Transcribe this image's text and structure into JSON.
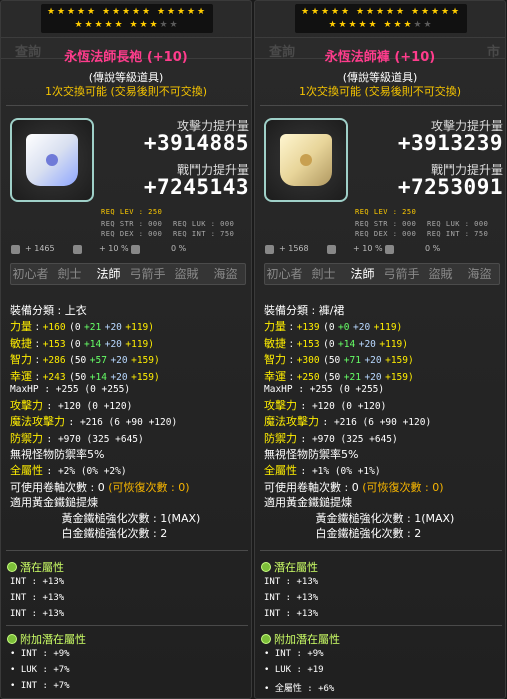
{
  "left": {
    "stars_row1": [
      1,
      1,
      1,
      1,
      1,
      1,
      1,
      1,
      1,
      1,
      1,
      1,
      1,
      1,
      1
    ],
    "stars_row2": [
      1,
      1,
      1,
      1,
      1,
      1,
      1,
      1,
      0,
      0
    ],
    "title": "永恆法師長袍 (+10)",
    "grade": "(傳說等級道具)",
    "trade": "1次交換可能 (交易後則不可交換)",
    "atk_label": "攻擊力提升量",
    "atk_value": "+3914885",
    "bp_label": "戰鬥力提升量",
    "bp_value": "+7245143",
    "req_lev_label": "REQ LEV :",
    "req_lev_value": "250",
    "req_str": "REQ STR : 000",
    "req_luk": "REQ LUK : 000",
    "req_dex": "REQ DEX : 000",
    "req_int": "REQ INT : 750",
    "misc_growth": "+ 1465",
    "misc_pct1": "+ 10 %",
    "misc_pct2": "0 %",
    "jobs": [
      "初心者",
      "劍士",
      "法師",
      "弓箭手",
      "盜賊",
      "海盜"
    ],
    "active_job": 2,
    "category": "裝備分類 : 上衣",
    "stats": [
      {
        "name": "力量",
        "total": "+160",
        "base": "(0",
        "a": "+21",
        "b": "+20",
        "c": "+119)"
      },
      {
        "name": "敏捷",
        "total": "+153",
        "base": "(0",
        "a": "+14",
        "b": "+20",
        "c": "+119)"
      },
      {
        "name": "智力",
        "total": "+286",
        "base": "(50",
        "a": "+57",
        "b": "+20",
        "c": "+159)"
      },
      {
        "name": "幸運",
        "total": "+243",
        "base": "(50",
        "a": "+14",
        "b": "+20",
        "c": "+159)"
      }
    ],
    "maxhp": "MaxHP : +255 (0 +255)",
    "atk_stat_label": "攻擊力",
    "atk_stat": ": +120 (0 +120)",
    "matk_label": "魔法攻擊力",
    "matk": ": +216 (6 +90 +120)",
    "def_label": "防禦力",
    "def": ": +970 (325 +645)",
    "ignore_def": "無視怪物防禦率5%",
    "allstat_label": "全屬性",
    "allstat": ": +2% (0% +2%)",
    "scroll_label": "可使用卷軸次數 : 0",
    "scroll_recover": "(可恢復次數 : 0)",
    "hammer_title": "適用黃金鐵鎚提煉",
    "gold_hammer": "黃金鐵槌強化次數 : 1(MAX)",
    "white_hammer": "白金鐵槌強化次數 : 2",
    "potential_label": "潛在屬性",
    "potentials": [
      "INT : +13%",
      "INT : +13%",
      "INT : +13%"
    ],
    "add_potential_label": "附加潛在屬性",
    "add_potentials": [
      "• INT : +9%",
      "• LUK : +7%",
      "• INT : +7%"
    ]
  },
  "right": {
    "stars_row1": [
      1,
      1,
      1,
      1,
      1,
      1,
      1,
      1,
      1,
      1,
      1,
      1,
      1,
      1,
      1
    ],
    "stars_row2": [
      1,
      1,
      1,
      1,
      1,
      1,
      1,
      1,
      0,
      0
    ],
    "title": "永恆法師褲 (+10)",
    "grade": "(傳說等級道具)",
    "trade": "1次交換可能 (交易後則不可交換)",
    "atk_label": "攻擊力提升量",
    "atk_value": "+3913239",
    "bp_label": "戰鬥力提升量",
    "bp_value": "+7253091",
    "req_lev_label": "REQ LEV :",
    "req_lev_value": "250",
    "req_str": "REQ STR : 000",
    "req_luk": "REQ LUK : 000",
    "req_dex": "REQ DEX : 000",
    "req_int": "REQ INT : 750",
    "misc_growth": "+ 1568",
    "misc_pct1": "+ 10 %",
    "misc_pct2": "0 %",
    "jobs": [
      "初心者",
      "劍士",
      "法師",
      "弓箭手",
      "盜賊",
      "海盜"
    ],
    "active_job": 2,
    "category": "裝備分類 : 褲/裙",
    "stats": [
      {
        "name": "力量",
        "total": "+139",
        "base": "(0",
        "a": "+0",
        "b": "+20",
        "c": "+119)"
      },
      {
        "name": "敏捷",
        "total": "+153",
        "base": "(0",
        "a": "+14",
        "b": "+20",
        "c": "+119)"
      },
      {
        "name": "智力",
        "total": "+300",
        "base": "(50",
        "a": "+71",
        "b": "+20",
        "c": "+159)"
      },
      {
        "name": "幸運",
        "total": "+250",
        "base": "(50",
        "a": "+21",
        "b": "+20",
        "c": "+159)"
      }
    ],
    "maxhp": "MaxHP : +255 (0 +255)",
    "atk_stat_label": "攻擊力",
    "atk_stat": ": +120 (0 +120)",
    "matk_label": "魔法攻擊力",
    "matk": ": +216 (6 +90 +120)",
    "def_label": "防禦力",
    "def": ": +970 (325 +645)",
    "ignore_def": "無視怪物防禦率5%",
    "allstat_label": "全屬性",
    "allstat": ": +1% (0% +1%)",
    "scroll_label": "可使用卷軸次數 : 0",
    "scroll_recover": "(可恢復次數 : 0)",
    "hammer_title": "適用黃金鐵鎚提煉",
    "gold_hammer": "黃金鐵槌強化次數 : 1(MAX)",
    "white_hammer": "白金鐵槌強化次數 : 2",
    "potential_label": "潛在屬性",
    "potentials": [
      "INT : +13%",
      "INT : +13%",
      "INT : +13%"
    ],
    "add_potential_label": "附加潛在屬性",
    "add_potentials": [
      "• INT : +9%",
      "• LUK : +19",
      "• 全屬性 : +6%"
    ]
  },
  "ghost": {
    "search_left": "查詢",
    "search_right": "查詢",
    "market": "市"
  },
  "colors": {
    "title_pink": "#ff3c8c",
    "trade_yellow": "#f5c400",
    "stat_yellow": "#ffee00",
    "bonus_green": "#66ff66",
    "potential_green": "#ccff66"
  }
}
